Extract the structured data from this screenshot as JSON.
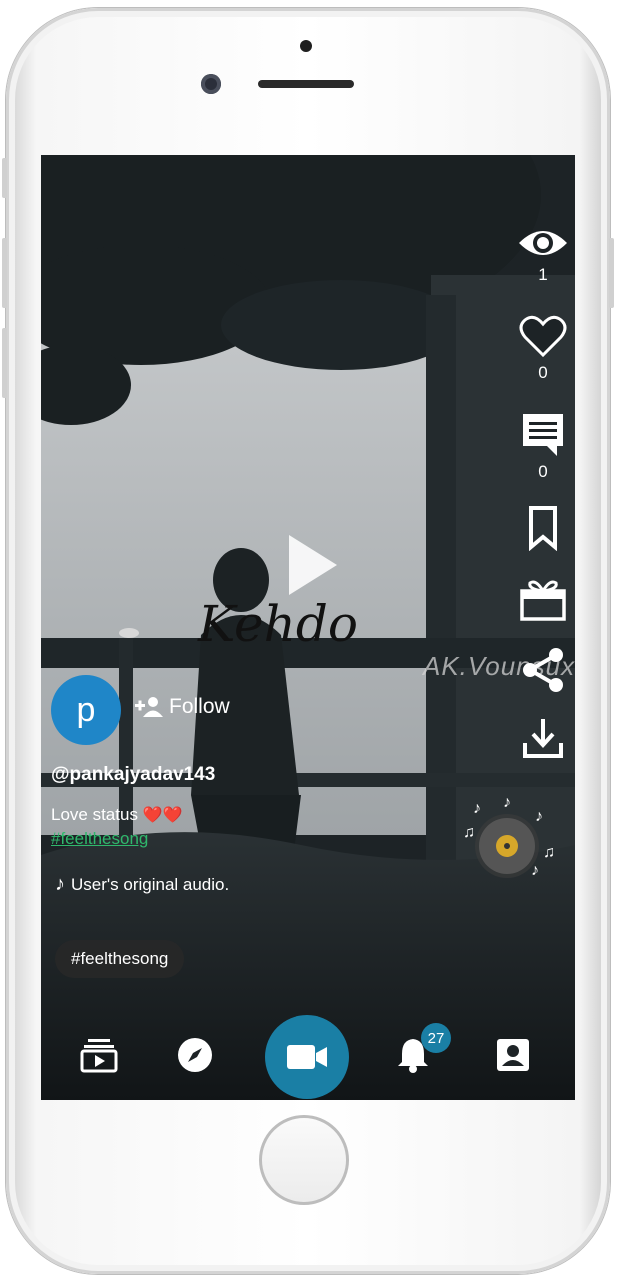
{
  "video": {
    "overlay_text": "Kehdo",
    "watermark": "AK.Vounsuxe"
  },
  "right_actions": {
    "views_count": "1",
    "likes_count": "0",
    "comments_count": "0"
  },
  "creator": {
    "avatar_letter": "p",
    "follow_label": "Follow",
    "username": "@pankajyadav143",
    "caption": "Love status",
    "caption_emoji": "❤️❤️",
    "hashtag": "#feelthesong",
    "audio": "User's original audio."
  },
  "hashtag_chip": "#feelthesong",
  "bottom_nav": {
    "notifications_badge": "27"
  },
  "colors": {
    "accent": "#1a7fa5",
    "avatar": "#1f86c8",
    "hashtag": "#2fb86c"
  }
}
